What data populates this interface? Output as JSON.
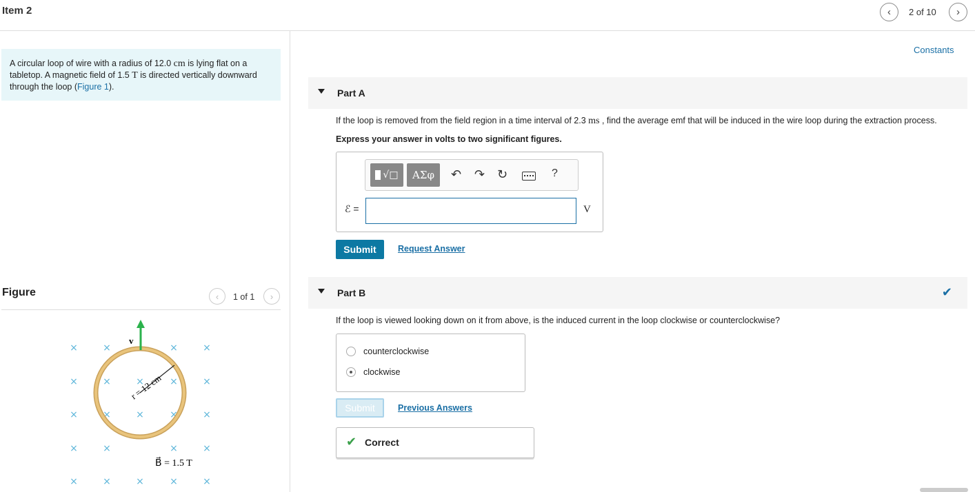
{
  "header": {
    "item_title": "Item 2",
    "prev_icon": "chevron-left-icon",
    "next_icon": "chevron-right-icon",
    "item_count": "2 of 10"
  },
  "problem": {
    "text_1": "A circular loop of wire with a radius of 12.0 ",
    "unit_cm": "cm",
    "text_2": " is lying flat on a tabletop. A magnetic field of 1.5 ",
    "unit_T": "T",
    "text_3": " is directed vertically downward through the loop (",
    "figure_link": "Figure 1",
    "text_4": ")."
  },
  "figure": {
    "title": "Figure",
    "count": "1 of 1",
    "radius_label": "r = 12 cm",
    "v_label": "v⃗",
    "b_label": "B⃗ = 1.5 T",
    "loop_color": "#e2b56a",
    "arrow_color": "#2bb24c",
    "cross_color": "#5bb5d9"
  },
  "constants_link": "Constants",
  "part_a": {
    "label": "Part A",
    "question_1": "If the loop is removed from the field region in a time interval of 2.3 ",
    "question_unit": "ms",
    "question_2": " , find the average emf that will be induced in the wire loop during the extraction process.",
    "instruction": "Express your answer in volts to two significant figures.",
    "toolbar": {
      "templates_icon": "templates-icon",
      "greek": "ΑΣφ",
      "undo_icon": "undo-icon",
      "redo_icon": "redo-icon",
      "reset_icon": "reset-icon",
      "keyboard_icon": "keyboard-icon",
      "help": "?"
    },
    "eq_label": "ℰ =",
    "answer_value": "",
    "unit": "V",
    "submit": "Submit",
    "request_answer": "Request Answer"
  },
  "part_b": {
    "label": "Part B",
    "status_icon": "checkmark-icon",
    "question": "If the loop is viewed looking down on it from above, is the induced current in the loop clockwise or counterclockwise?",
    "options": [
      {
        "label": "counterclockwise",
        "selected": false
      },
      {
        "label": "clockwise",
        "selected": true
      }
    ],
    "submit": "Submit",
    "previous_answers": "Previous Answers",
    "feedback": "Correct",
    "feedback_color": "#3aa04a"
  }
}
